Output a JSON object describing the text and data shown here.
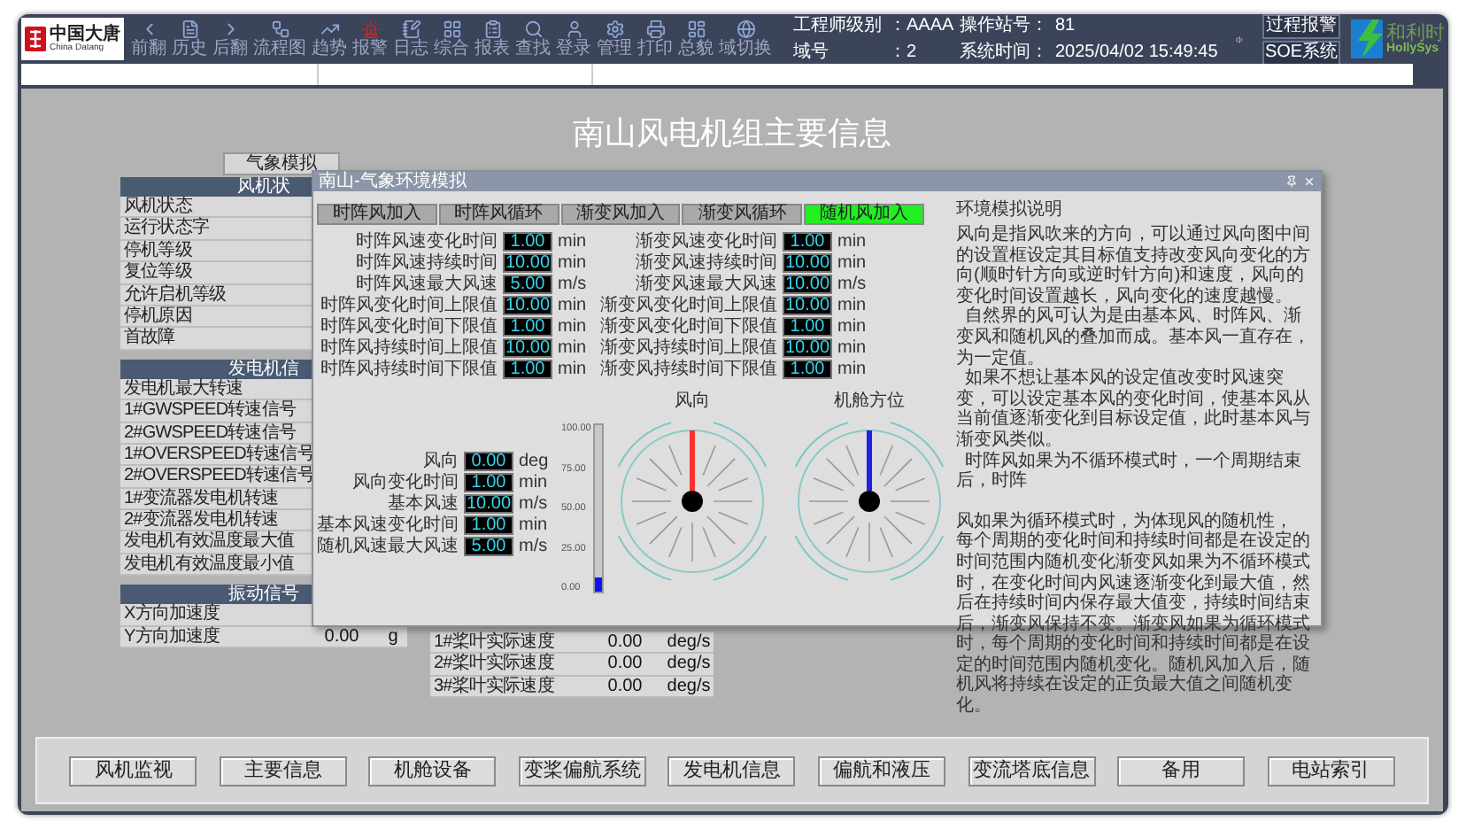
{
  "toolbar": {
    "logo": {
      "name": "中国大唐",
      "subtitle": "China Datang"
    },
    "buttons": [
      "前翻",
      "历史",
      "后翻",
      "流程图",
      "趋势",
      "报警",
      "日志",
      "综合",
      "报表",
      "查找",
      "登录",
      "管理",
      "打印",
      "总貌",
      "域切换"
    ],
    "info": [
      {
        "label": "工程师级别",
        "value": "：AAAA"
      },
      {
        "label": "操作站号：",
        "value": "81"
      },
      {
        "label": "域号",
        "value": "：2"
      },
      {
        "label": "系统时间：",
        "value": "2025/04/02 15:49:45"
      }
    ],
    "alarm_buttons": [
      "过程报警",
      "SOE系统"
    ],
    "brand": {
      "name": "和利时",
      "latin": "HollySys"
    }
  },
  "title": "南山风电机组主要信息",
  "weather_button": "气象模拟",
  "status_panels": [
    {
      "header": "风机状",
      "rows": [
        {
          "label": "风机状态"
        },
        {
          "label": "运行状态字"
        },
        {
          "label": "停机等级"
        },
        {
          "label": "复位等级"
        },
        {
          "label": "允许启机等级"
        },
        {
          "label": "停机原因"
        },
        {
          "label": "首故障"
        }
      ]
    },
    {
      "header": "发电机信",
      "rows": [
        {
          "label": "发电机最大转速"
        },
        {
          "label": "1#GWSPEED转速信号"
        },
        {
          "label": "2#GWSPEED转速信号"
        },
        {
          "label": "1#OVERSPEED转速信号"
        },
        {
          "label": "2#OVERSPEED转速信号"
        },
        {
          "label": "1#变流器发电机转速"
        },
        {
          "label": "2#变流器发电机转速"
        },
        {
          "label": "发电机有效温度最大值"
        },
        {
          "label": "发电机有效温度最小值"
        }
      ]
    },
    {
      "header": "振动信号",
      "rows": [
        {
          "label": "X方向加速度"
        },
        {
          "label": "Y方向加速度",
          "value": "0.00",
          "unit": "g"
        }
      ]
    }
  ],
  "blade_table": [
    {
      "label": "1#桨叶实际速度",
      "value": "0.00",
      "unit": "deg/s"
    },
    {
      "label": "2#桨叶实际速度",
      "value": "0.00",
      "unit": "deg/s"
    },
    {
      "label": "3#桨叶实际速度",
      "value": "0.00",
      "unit": "deg/s"
    }
  ],
  "dialog": {
    "title": "南山-气象环境模拟",
    "tabs": [
      {
        "label": "时阵风加入",
        "on": false
      },
      {
        "label": "时阵风循环",
        "on": false
      },
      {
        "label": "渐变风加入",
        "on": false
      },
      {
        "label": "渐变风循环",
        "on": false
      },
      {
        "label": "随机风加入",
        "on": true
      }
    ],
    "gust_params": [
      {
        "label": "时阵风速变化时间",
        "value": "1.00",
        "unit": "min"
      },
      {
        "label": "时阵风速持续时间",
        "value": "10.00",
        "unit": "min"
      },
      {
        "label": "时阵风速最大风速",
        "value": "5.00",
        "unit": "m/s"
      },
      {
        "label": "时阵风变化时间上限值",
        "value": "10.00",
        "unit": "min"
      },
      {
        "label": "时阵风变化时间下限值",
        "value": "1.00",
        "unit": "min"
      },
      {
        "label": "时阵风持续时间上限值",
        "value": "10.00",
        "unit": "min"
      },
      {
        "label": "时阵风持续时间下限值",
        "value": "1.00",
        "unit": "min"
      }
    ],
    "ramp_params": [
      {
        "label": "渐变风速变化时间",
        "value": "1.00",
        "unit": "min"
      },
      {
        "label": "渐变风速持续时间",
        "value": "10.00",
        "unit": "min"
      },
      {
        "label": "渐变风速最大风速",
        "value": "10.00",
        "unit": "m/s"
      },
      {
        "label": "渐变风变化时间上限值",
        "value": "10.00",
        "unit": "min"
      },
      {
        "label": "渐变风变化时间下限值",
        "value": "1.00",
        "unit": "min"
      },
      {
        "label": "渐变风持续时间上限值",
        "value": "10.00",
        "unit": "min"
      },
      {
        "label": "渐变风持续时间下限值",
        "value": "1.00",
        "unit": "min"
      }
    ],
    "base_params": [
      {
        "label": "风向",
        "value": "0.00",
        "unit": "deg"
      },
      {
        "label": "风向变化时间",
        "value": "1.00",
        "unit": "min"
      },
      {
        "label": "基本风速",
        "value": "10.00",
        "unit": "m/s"
      },
      {
        "label": "基本风速变化时间",
        "value": "1.00",
        "unit": "min"
      },
      {
        "label": "随机风速最大风速",
        "value": "5.00",
        "unit": "m/s"
      }
    ],
    "speed_gauge": {
      "level": 0.09,
      "ticks": [
        "100.00",
        "75.00",
        "50.00",
        "25.00",
        "0.00"
      ]
    },
    "compasses": [
      {
        "title": "风向",
        "color": "#ff3030"
      },
      {
        "title": "机舱方位",
        "color": "#2020e8"
      }
    ],
    "help": {
      "title": "环境模拟说明",
      "paragraphs": [
        {
          "text": "风向是指风吹来的方向，可以通过风向图中间的设置框设定其目标值支持改变风向变化的方向(顺时针方向或逆时针方向)和速度，风向的变化时间设置越长，风向变化的速度越慢。",
          "indent": false,
          "break_after": false
        },
        {
          "text": "自然界的风可认为是由基本风、时阵风、渐变风和随机风的叠加而成。基本风一直存在，为一定值。",
          "indent": true,
          "break_after": false
        },
        {
          "text": "如果不想让基本风的设定值改变时风速突变，可以设定基本风的变化时间，使基本风从当前值逐渐变化到目标设定值，此时基本风与渐变风类似。",
          "indent": true,
          "break_after": false
        },
        {
          "text": "时阵风如果为不循环模式时，一个周期结束后，时阵",
          "indent": true,
          "break_after": true
        },
        {
          "text": "风如果为循环模式时，为体现风的随机性，",
          "indent": false,
          "break_after": false
        },
        {
          "text": "每个周期的变化时间和持续时间都是在设定的时间范围内随机变化渐变风如果为不循环模式时，在变化时间内风速逐渐变化到最大值，然后在持续时间内保存最大值变，持续时间结束后，渐变风保持不变。渐变风如果为循环模式时，每个周期的变化时间和持续时间都是在设定的时间范围内随机变化。随机风加入后，随机风将持续在设定的正负最大值之间随机变化。",
          "indent": false,
          "break_after": false
        }
      ]
    }
  },
  "nav_buttons": [
    "风机监视",
    "主要信息",
    "机舱设备",
    "变桨偏航系统",
    "发电机信息",
    "偏航和液压",
    "变流塔底信息",
    "备用",
    "电站索引"
  ]
}
